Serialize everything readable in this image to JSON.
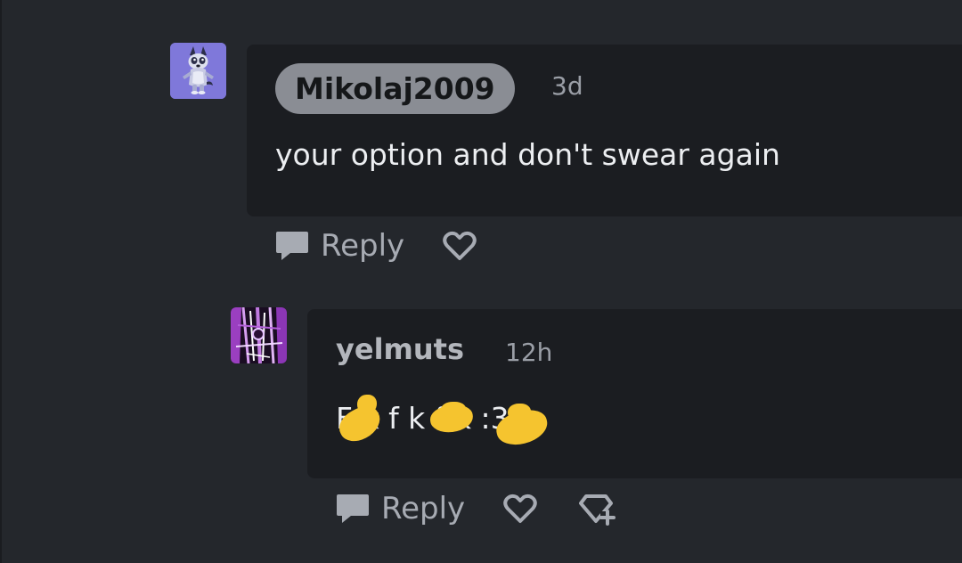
{
  "comments": [
    {
      "username": "Mikolaj2009",
      "time": "3d",
      "text": "your option and don't swear again",
      "avatar": "bluey-character-avatar",
      "actions": {
        "reply_label": "Reply"
      }
    },
    {
      "username": "yelmuts",
      "time": "12h",
      "text": "F k f k f k :3",
      "avatar": "purple-dark-art-avatar",
      "actions": {
        "reply_label": "Reply"
      }
    }
  ],
  "icons": {
    "reply": "speech-bubble-icon",
    "heart": "heart-outline-icon",
    "award": "award-add-icon"
  },
  "colors": {
    "background": "#24272c",
    "bubble": "#1b1d21",
    "pill": "#8a8d94",
    "muted_text": "#a7abb3",
    "redaction": "#f5c42f",
    "avatar_1_bg": "#7f78da"
  }
}
